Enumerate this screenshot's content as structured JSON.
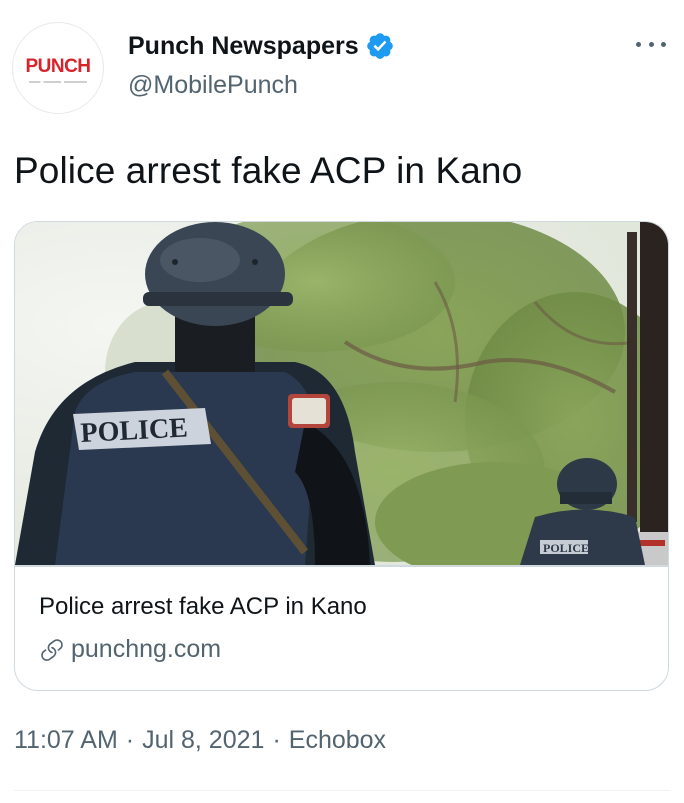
{
  "author": {
    "display_name": "Punch Newspapers",
    "handle": "@MobilePunch",
    "verified": true,
    "avatar_logo_text": "PUNCH"
  },
  "tweet": {
    "text": "Police arrest fake ACP in Kano"
  },
  "card": {
    "title": "Police arrest fake ACP in Kano",
    "domain": "punchng.com",
    "image_labels": {
      "vest_main": "POLICE",
      "vest_secondary": "POLICE"
    }
  },
  "meta": {
    "time": "11:07 AM",
    "date": "Jul 8, 2021",
    "source": "Echobox",
    "separator": "·"
  },
  "icons": {
    "verified": "verified-badge-icon",
    "more": "more-options-icon",
    "link": "link-icon"
  },
  "colors": {
    "verified_blue": "#1d9bf0",
    "punch_red": "#d8232a",
    "secondary_text": "#536471",
    "primary_text": "#0f1419"
  }
}
